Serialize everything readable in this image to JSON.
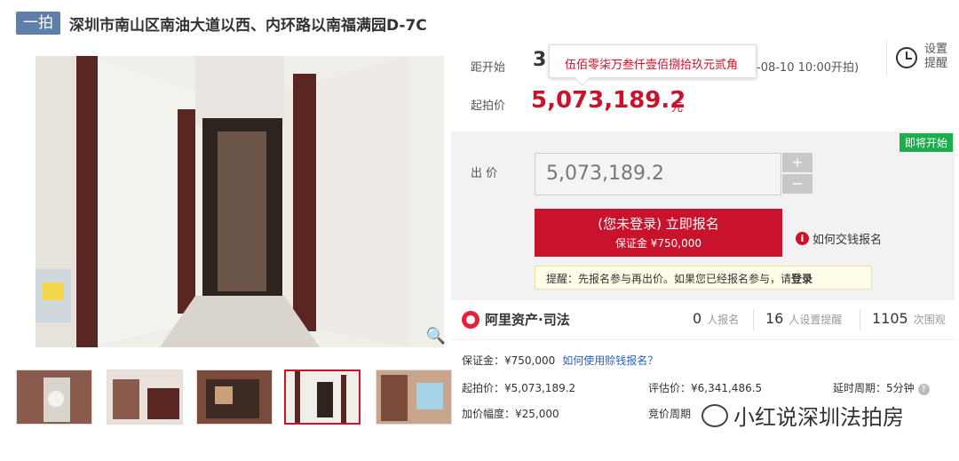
{
  "header": {
    "badge": "一拍",
    "title": "深圳市南山区南油大道以西、内环路以南福满园D-7C"
  },
  "countdown": {
    "label": "距开始",
    "value": "3",
    "tooltip": "伍佰零柒万叁仟壹佰捌拾玖元贰角",
    "start_time": "-08-10 10:00开拍)"
  },
  "alarm": {
    "label": "设置提醒"
  },
  "start_price": {
    "label": "起拍价",
    "value": "5,073,189.2",
    "unit": "元"
  },
  "bid": {
    "status": "即将开始",
    "label": "出 价",
    "input_value": "5,073,189.2",
    "plus": "+",
    "minus": "−"
  },
  "sign_button": {
    "line1": "(您未登录) 立即报名",
    "line2": "保证金 ¥750,000"
  },
  "howto": {
    "icon": "i",
    "label": "如何交钱报名"
  },
  "reminder": {
    "text": "提醒：先报名参与再出价。如果您已经报名参与，请",
    "link": "登录"
  },
  "ali": {
    "brand": "阿里资产·司法"
  },
  "stats": [
    {
      "num": "0",
      "label": "人报名"
    },
    {
      "num": "16",
      "label": "人设置提醒"
    },
    {
      "num": "1105",
      "label": "次围观"
    }
  ],
  "details": {
    "deposit": "保证金：¥750,000",
    "deposit_link": "如何使用赊钱报名？",
    "start_price": "起拍价：¥5,073,189.2",
    "appraisal": "评估价：¥6,341,486.5",
    "delay": "延时周期：5分钟",
    "increment": "加价幅度：¥25,000",
    "auction_period": "竞价周期"
  },
  "watermark": "小红说深圳法拍房",
  "colors": {
    "accent": "#c9122b",
    "badge": "#5d7fa8",
    "status_green": "#1bad4e"
  }
}
